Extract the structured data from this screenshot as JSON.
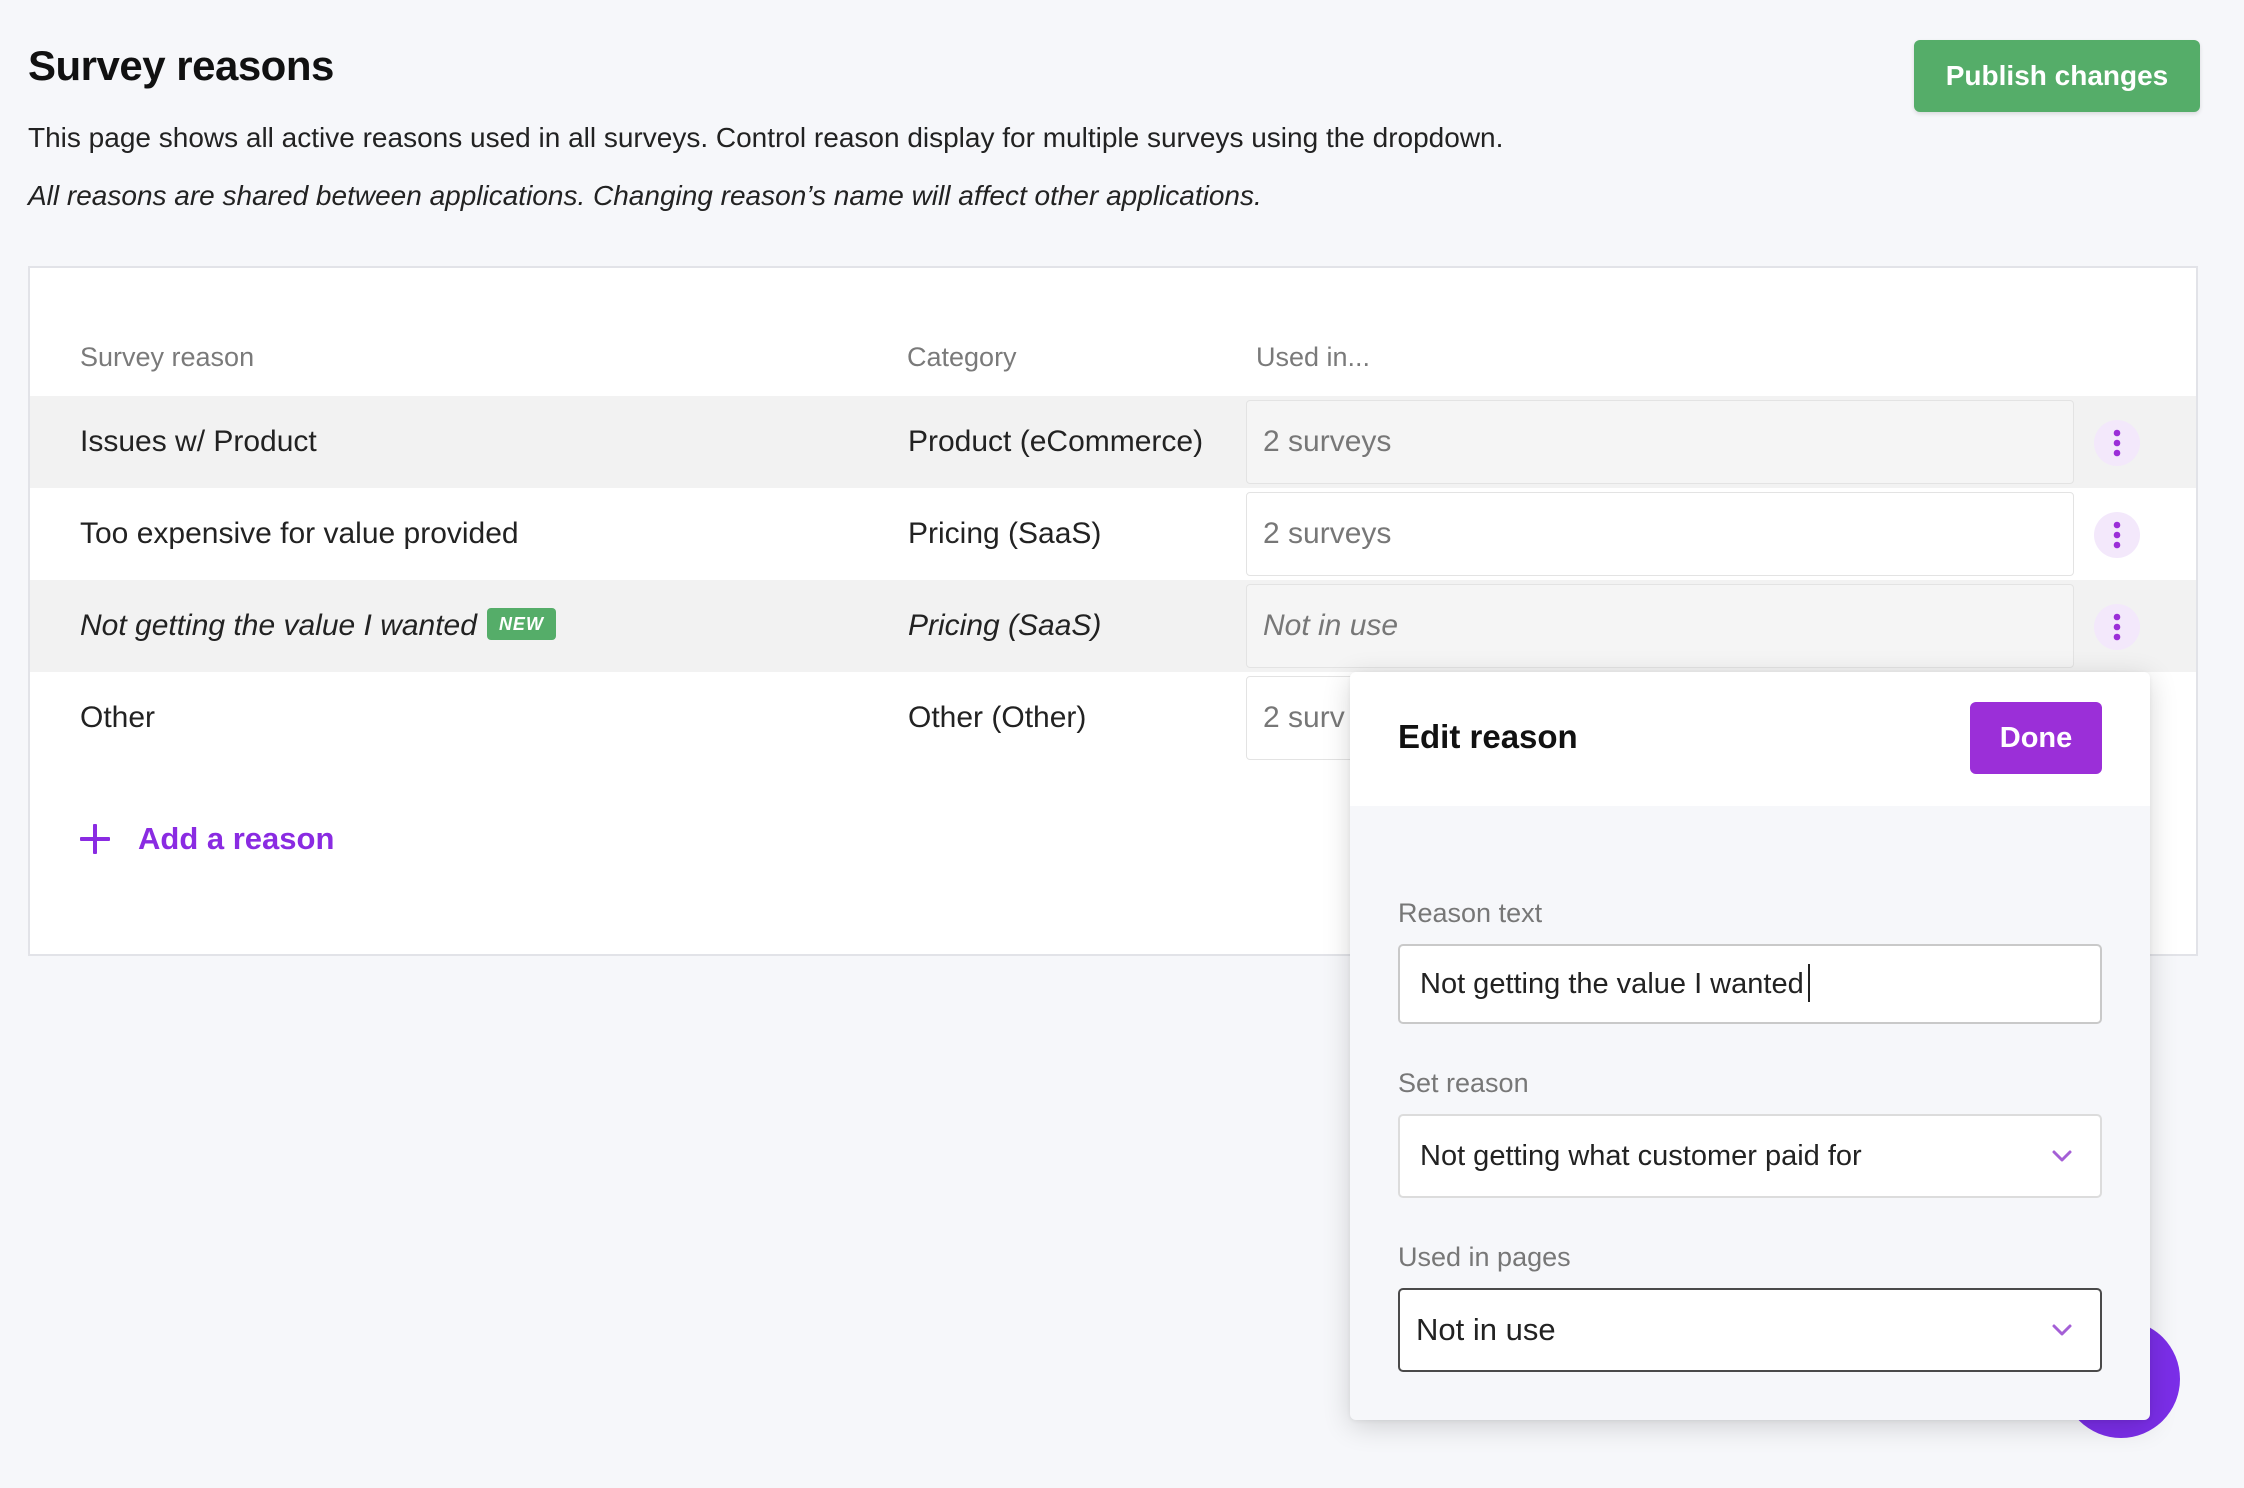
{
  "header": {
    "title": "Survey reasons",
    "description": "This page shows all active reasons used in all surveys. Control reason display for multiple surveys using the dropdown.",
    "note": "All reasons are shared between applications. Changing reason’s name will affect other applications.",
    "publish_label": "Publish changes"
  },
  "table": {
    "columns": [
      "Survey reason",
      "Category",
      "Used in..."
    ],
    "rows": [
      {
        "reason": "Issues w/ Product",
        "category": "Product (eCommerce)",
        "used_in": "2 surveys"
      },
      {
        "reason": "Too expensive for value provided",
        "category": "Pricing (SaaS)",
        "used_in": "2 surveys"
      },
      {
        "reason": "Not getting the value I wanted",
        "badge": "NEW",
        "category": "Pricing (SaaS)",
        "used_in": "Not in use"
      },
      {
        "reason": "Other",
        "category": "Other (Other)",
        "used_in": "2 surv"
      }
    ],
    "add_label": "Add a reason"
  },
  "edit_panel": {
    "title": "Edit reason",
    "done_label": "Done",
    "reason_text_label": "Reason text",
    "reason_text_value": "Not getting the value I wanted",
    "set_reason_label": "Set reason",
    "set_reason_value": "Not getting what customer paid for",
    "used_in_pages_label": "Used in pages",
    "used_in_pages_value": "Not in use"
  },
  "icons": {
    "row_menu": "kebab-menu-icon",
    "add": "plus-icon",
    "dropdown": "chevron-down-icon"
  },
  "colors": {
    "publish": "#55ad69",
    "accent_purple": "#8a2be2",
    "done": "#9b2fd8",
    "badge_new": "#55ad69"
  }
}
